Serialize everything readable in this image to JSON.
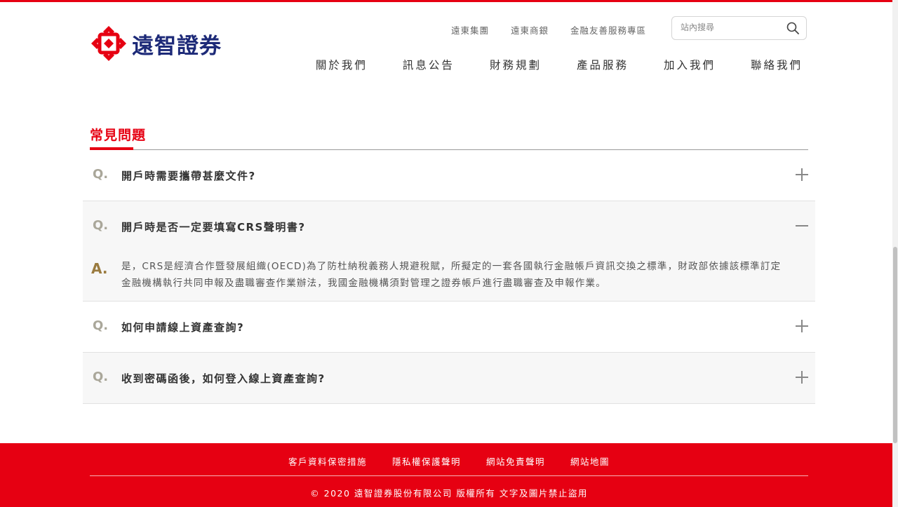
{
  "colors": {
    "brand_red": "#e60012",
    "brand_navy": "#1d2a78",
    "q_mark": "#aaa79a",
    "a_mark": "#9a7b3f"
  },
  "logo": {
    "text": "遠智證券",
    "icon": "knot-logo-icon"
  },
  "utility_links": [
    "遠東集團",
    "遠東商銀",
    "金融友善服務專區"
  ],
  "search": {
    "placeholder": "站內搜尋",
    "icon": "search-icon"
  },
  "nav": [
    "關於我們",
    "訊息公告",
    "財務規劃",
    "產品服務",
    "加入我們",
    "聯絡我們"
  ],
  "page": {
    "title": "常見問題"
  },
  "faq": {
    "q_label": "Q.",
    "a_label": "A.",
    "items": [
      {
        "question": "開戶時需要攜帶甚麼文件?",
        "expanded": false
      },
      {
        "question": "開戶時是否一定要填寫CRS聲明書?",
        "expanded": true,
        "answer": "是，CRS是經濟合作暨發展組織(OECD)為了防杜納稅義務人規避稅賦，所擬定的一套各國執行金融帳戶資訊交換之標準，財政部依據該標準訂定金融機構執行共同申報及盡職審查作業辦法，我國金融機構須對管理之證券帳戶進行盡職審查及申報作業。"
      },
      {
        "question": "如何申請線上資產查詢?",
        "expanded": false
      },
      {
        "question": "收到密碼函後，如何登入線上資產查詢?",
        "expanded": false
      }
    ]
  },
  "footer": {
    "links": [
      "客戶資料保密措施",
      "隱私權保護聲明",
      "網站免責聲明",
      "網站地圖"
    ],
    "copyright": "© 2020 遠智證券股份有限公司 版權所有 文字及圖片禁止盜用"
  }
}
